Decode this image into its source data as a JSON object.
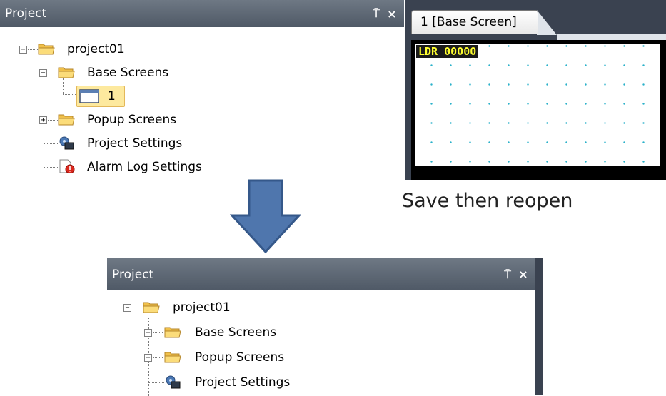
{
  "top_panel": {
    "title": "Project",
    "pin_glyph": "⍑",
    "close_glyph": "×",
    "tree": {
      "root": "project01",
      "base_screens": "Base Screens",
      "screen_1": "1",
      "popup_screens": "Popup Screens",
      "project_settings": "Project Settings",
      "alarm_log_settings": "Alarm Log Settings"
    }
  },
  "editor": {
    "tab_label": "1  [Base Screen]",
    "ldr_tag": "LDR 00000"
  },
  "caption": "Save then reopen",
  "bottom_panel": {
    "title": "Project",
    "pin_glyph": "⍑",
    "close_glyph": "×",
    "tree": {
      "root": "project01",
      "base_screens": "Base Screens",
      "popup_screens": "Popup Screens",
      "project_settings": "Project Settings"
    }
  },
  "icons": {
    "folder": "folder-icon",
    "screen": "screen-icon",
    "settings": "project-settings-icon",
    "alarm": "alarm-log-icon",
    "arrow": "down-arrow-icon"
  },
  "colors": {
    "header_bg": "#5b6572",
    "folder_fill": "#f7cf5a",
    "arrow_fill": "#4f76ad",
    "selection_bg": "#fde99e",
    "ldr_text": "#ffff2e"
  }
}
